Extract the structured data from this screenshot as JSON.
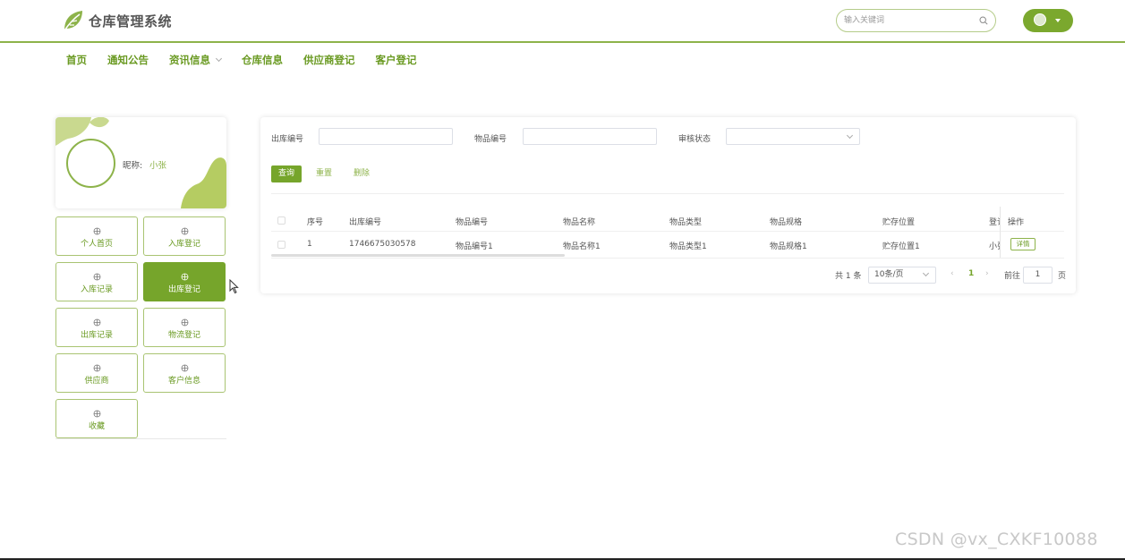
{
  "app": {
    "title": "仓库管理系统"
  },
  "header": {
    "search_placeholder": "输入关键词",
    "accent_color": "#76a52b"
  },
  "nav": {
    "items": [
      {
        "label": "首页"
      },
      {
        "label": "通知公告"
      },
      {
        "label": "资讯信息"
      },
      {
        "label": "仓库信息"
      },
      {
        "label": "供应商登记"
      },
      {
        "label": "客户登记"
      }
    ]
  },
  "profile": {
    "nick_label": "昵称:",
    "nick_value": "小张"
  },
  "sidebar": {
    "items": [
      {
        "label": "个人首页"
      },
      {
        "label": "入库登记"
      },
      {
        "label": "入库记录"
      },
      {
        "label": "出库登记",
        "active": true
      },
      {
        "label": "出库记录"
      },
      {
        "label": "物流登记"
      },
      {
        "label": "供应商"
      },
      {
        "label": "客户信息"
      },
      {
        "label": "收藏"
      }
    ]
  },
  "filters": {
    "outbound_no_label": "出库编号",
    "item_no_label": "物品编号",
    "status_label": "审核状态"
  },
  "actions": {
    "query": "查询",
    "reset": "重置",
    "delete": "删除"
  },
  "table": {
    "headers": [
      "序号",
      "出库编号",
      "物品编号",
      "物品名称",
      "物品类型",
      "物品规格",
      "贮存位置",
      "登记",
      "操作"
    ],
    "rows": [
      {
        "index": "1",
        "outbound_no": "1746675030578",
        "item_no": "物品编号1",
        "item_name": "物品名称1",
        "item_type": "物品类型1",
        "item_spec": "物品规格1",
        "location": "贮存位置1",
        "registrar": "小张",
        "action": "详情"
      }
    ]
  },
  "pagination": {
    "total": "共 1 条",
    "page_size": "10条/页",
    "current": "1",
    "goto_label": "前往",
    "goto_value": "1",
    "page_unit": "页"
  },
  "watermark": "CSDN @vx_CXKF10088"
}
